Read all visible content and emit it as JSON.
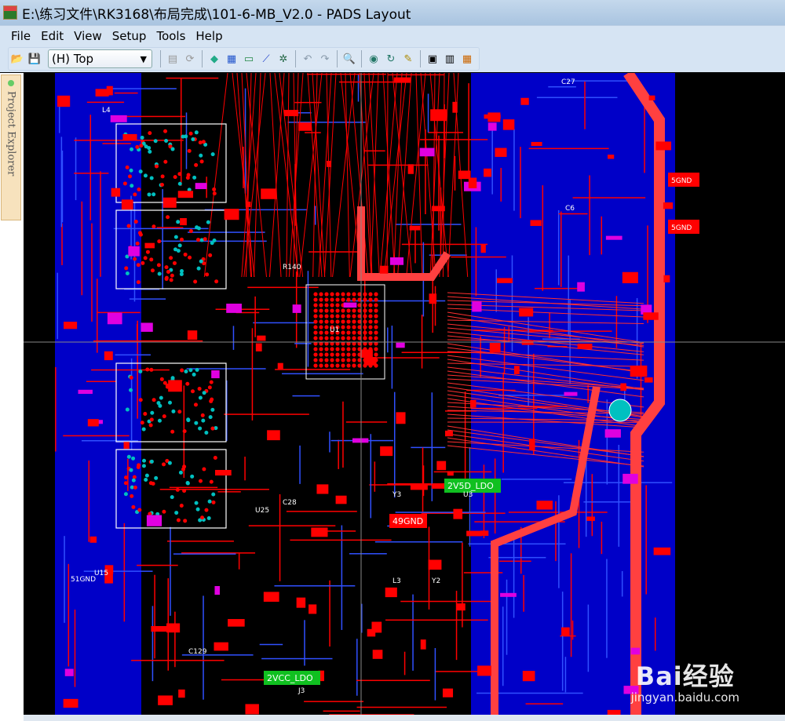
{
  "window": {
    "title": "E:\\练习文件\\RK3168\\布局完成\\101-6-MB_V2.0 - PADS Layout"
  },
  "menu": [
    "File",
    "Edit",
    "View",
    "Setup",
    "Tools",
    "Help"
  ],
  "toolbar": {
    "layer": "(H) Top",
    "icons": [
      "open-icon",
      "save-icon",
      "properties-icon",
      "refresh-icon",
      "design-toolbar-icon",
      "route-icon",
      "drafting-icon",
      "ecco-icon",
      "bga-icon",
      "undo-icon",
      "redo-icon",
      "zoom-icon",
      "verify-icon",
      "redraw-icon",
      "cam-icon",
      "view-icon",
      "pads-router-icon"
    ]
  },
  "explorer": {
    "label": "Project Explorer"
  },
  "pcb": {
    "labels": [
      "49GND",
      "2V5D_LDO",
      "2VCC_LDO",
      "5GND",
      "5GND",
      "51GND",
      "U1",
      "U3",
      "Y2",
      "Y3",
      "L3",
      "L4",
      "C6",
      "C27",
      "C28",
      "J3",
      "U15",
      "U25",
      "R140",
      "C129"
    ],
    "colors": {
      "top": "#ff0000",
      "bottom": "#0000ff",
      "outline": "#ffffff",
      "pad": "#00c0c0"
    }
  },
  "watermark": {
    "logo": "Bai经验",
    "url": "jingyan.baidu.com"
  }
}
